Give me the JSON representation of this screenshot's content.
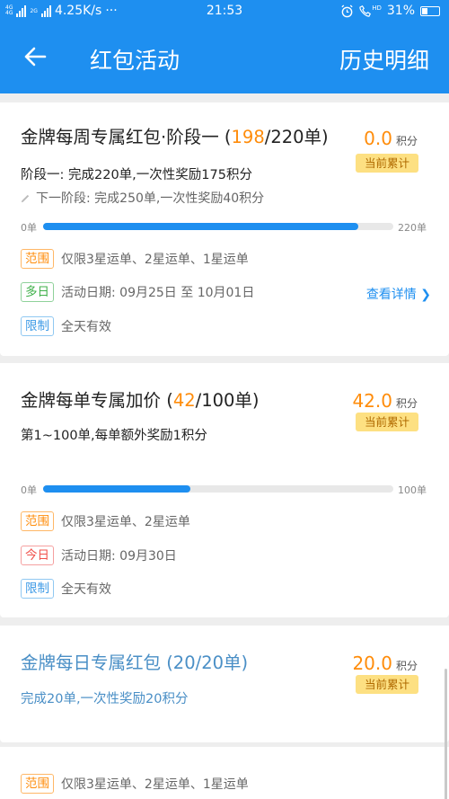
{
  "status_bar": {
    "network_labels": [
      "4G",
      "4G",
      "2G"
    ],
    "speed": "4.25K/s",
    "more": "···",
    "time": "21:53",
    "hd_label": "HD",
    "battery": "31%"
  },
  "app_bar": {
    "title": "红包活动",
    "history_label": "历史明细"
  },
  "cards": [
    {
      "title_prefix": "金牌每周专属红包·阶段一 (",
      "current": "198",
      "title_suffix": "/220单)",
      "points": "0.0",
      "points_unit": "积分",
      "accum_label": "当前累计",
      "desc": "阶段一: 完成220单,一次性奖励175积分",
      "next_stage": "下一阶段: 完成250单,一次性奖励40积分",
      "progress": {
        "min_label": "0单",
        "max_label": "220单",
        "value": 198,
        "max": 220
      },
      "tags": [
        {
          "label": "范围",
          "text": "仅限3星运单、2星运单、1星运单",
          "color": "orange"
        },
        {
          "label": "多日",
          "text": "活动日期: 09月25日 至 10月01日",
          "color": "green"
        },
        {
          "label": "限制",
          "text": "全天有效",
          "color": "blue"
        }
      ],
      "details_label": "查看详情"
    },
    {
      "title_prefix": "金牌每单专属加价 (",
      "current": "42",
      "title_suffix": "/100单)",
      "points": "42.0",
      "points_unit": "积分",
      "accum_label": "当前累计",
      "desc": "第1~100单,每单额外奖励1积分",
      "progress": {
        "min_label": "0单",
        "max_label": "100单",
        "value": 42,
        "max": 100
      },
      "tags": [
        {
          "label": "范围",
          "text": "仅限3星运单、2星运单",
          "color": "orange"
        },
        {
          "label": "今日",
          "text": "活动日期: 09月30日",
          "color": "red"
        },
        {
          "label": "限制",
          "text": "全天有效",
          "color": "blue"
        }
      ]
    },
    {
      "title": "金牌每日专属红包 (20/20单)",
      "points": "20.0",
      "points_unit": "积分",
      "accum_label": "当前累计",
      "desc": "完成20单,一次性奖励20积分"
    },
    {
      "tags": [
        {
          "label": "范围",
          "text": "仅限3星运单、2星运单、1星运单",
          "color": "orange"
        }
      ]
    }
  ],
  "colors": {
    "brand_blue": "#1e8ff0",
    "accent_orange": "#ff8c0a",
    "badge_yellow": "#fde082"
  }
}
